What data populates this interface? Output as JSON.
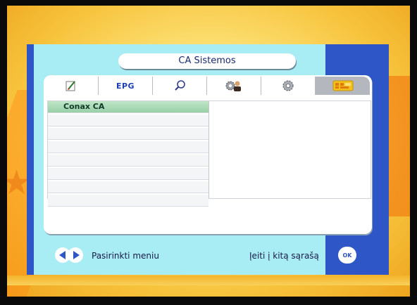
{
  "header": {
    "title": "CA Sistemos"
  },
  "tabs": [
    {
      "name": "edit",
      "label": ""
    },
    {
      "name": "epg",
      "label": "EPG"
    },
    {
      "name": "search",
      "label": ""
    },
    {
      "name": "installation",
      "label": ""
    },
    {
      "name": "settings",
      "label": ""
    },
    {
      "name": "ca",
      "label": ""
    }
  ],
  "list": {
    "items": [
      "Conax CA",
      "",
      "",
      "",
      "",
      "",
      "",
      ""
    ]
  },
  "footer": {
    "left_label": "Pasirinkti meniu",
    "right_label": "Įeiti į kitą sąrašą",
    "ok_label": "OK"
  },
  "colors": {
    "panel": "#2f56c6",
    "inner": "#a8ecf4",
    "selected": "#98d0a8"
  }
}
